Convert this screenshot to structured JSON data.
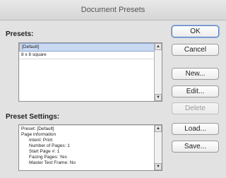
{
  "window": {
    "title": "Document Presets"
  },
  "presets": {
    "label": "Presets:",
    "items": [
      "[Default]",
      "8 x 8 square"
    ],
    "selected_index": 0
  },
  "settings": {
    "label": "Preset Settings:",
    "lines": [
      "Preset: [Default]",
      "Page information",
      "Intent: Print",
      "Number of Pages: 1",
      "Start Page #: 1",
      "Facing Pages: Yes",
      "Master Text Frame: No"
    ]
  },
  "buttons": {
    "ok": "OK",
    "cancel": "Cancel",
    "new": "New...",
    "edit": "Edit...",
    "delete": "Delete",
    "load": "Load...",
    "save": "Save..."
  },
  "icons": {
    "scroll_up": "scroll-up-arrow-icon",
    "scroll_down": "scroll-down-arrow-icon"
  },
  "colors": {
    "selection": "#c9d9f2",
    "default_button_border": "#5a7fc0"
  }
}
